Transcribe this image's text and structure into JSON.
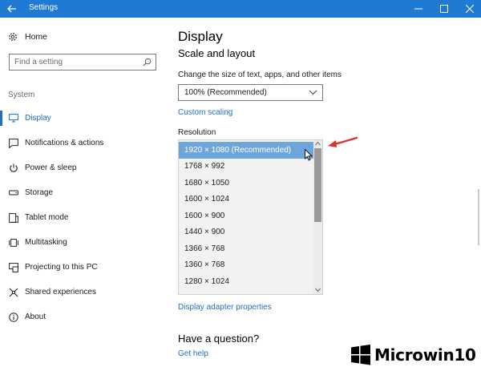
{
  "window": {
    "title": "Settings"
  },
  "sidebar": {
    "home_label": "Home",
    "search_placeholder": "Find a setting",
    "section_label": "System",
    "items": [
      {
        "label": "Display",
        "icon": "monitor-icon",
        "active": true
      },
      {
        "label": "Notifications & actions",
        "icon": "notification-icon",
        "active": false
      },
      {
        "label": "Power & sleep",
        "icon": "power-icon",
        "active": false
      },
      {
        "label": "Storage",
        "icon": "storage-icon",
        "active": false
      },
      {
        "label": "Tablet mode",
        "icon": "tablet-icon",
        "active": false
      },
      {
        "label": "Multitasking",
        "icon": "multitasking-icon",
        "active": false
      },
      {
        "label": "Projecting to this PC",
        "icon": "projecting-icon",
        "active": false
      },
      {
        "label": "Shared experiences",
        "icon": "shared-icon",
        "active": false
      },
      {
        "label": "About",
        "icon": "info-icon",
        "active": false
      }
    ]
  },
  "main": {
    "title": "Display",
    "subtitle": "Scale and layout",
    "scale_label": "Change the size of text, apps, and other items",
    "scale_value": "100% (Recommended)",
    "custom_scaling_link": "Custom scaling",
    "resolution_label": "Resolution",
    "resolutions": [
      "1920 × 1080 (Recommended)",
      "1768 × 992",
      "1680 × 1050",
      "1600 × 1024",
      "1600 × 900",
      "1440 × 900",
      "1366 × 768",
      "1360 × 768",
      "1280 × 1024"
    ],
    "selected_resolution": "1920 × 1080 (Recommended)",
    "adapter_link": "Display adapter properties",
    "question_title": "Have a question?",
    "help_link": "Get help"
  },
  "watermark": {
    "text": "Microwin10"
  },
  "colors": {
    "accent": "#1f7ad3",
    "link": "#1f6fc0",
    "selected": "#6ea6dc",
    "arrow": "#d9342b"
  }
}
